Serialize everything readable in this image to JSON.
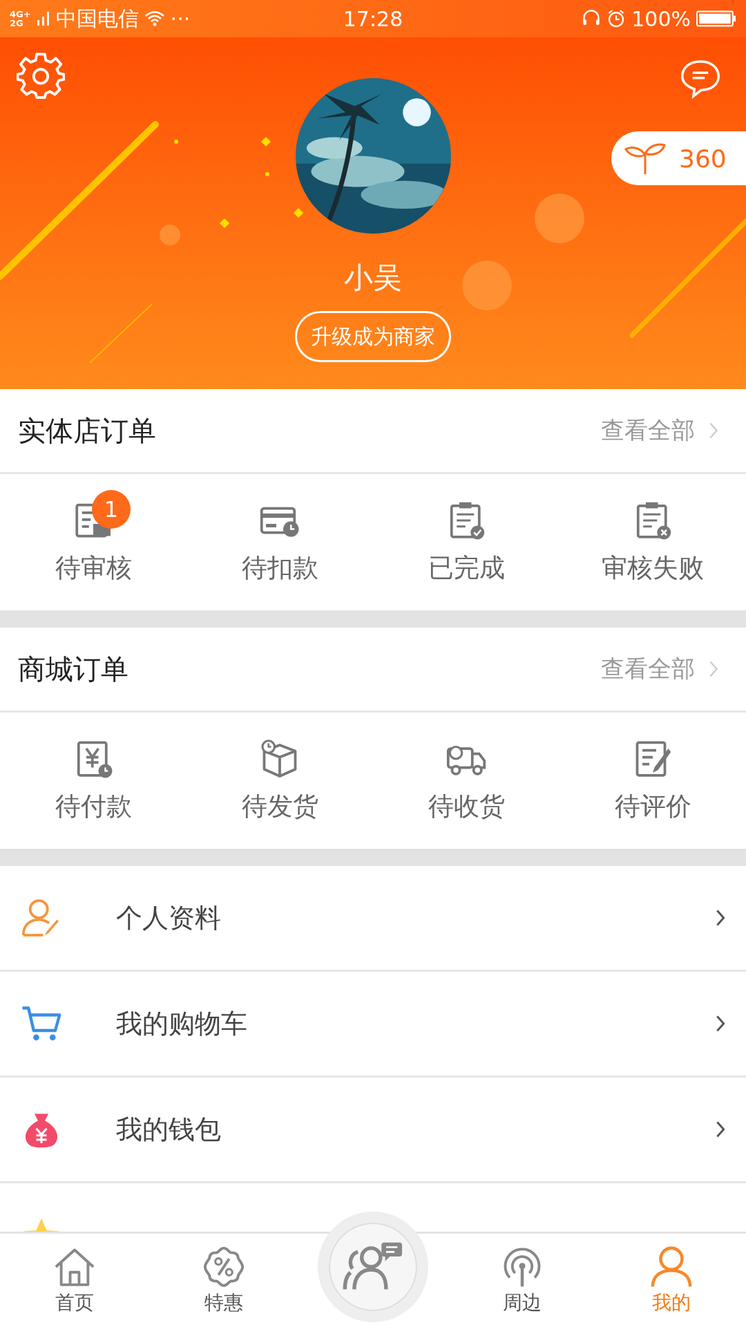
{
  "status_bar": {
    "network": [
      "4G+",
      "2G"
    ],
    "carrier": "中国电信",
    "more": "···",
    "time": "17:28",
    "battery": "100%"
  },
  "profile": {
    "name": "小吴",
    "upgrade_button": "升级成为商家",
    "points": "360"
  },
  "sections": [
    {
      "title": "实体店订单",
      "view_all": "查看全部",
      "items": [
        {
          "label": "待审核",
          "badge": "1"
        },
        {
          "label": "待扣款"
        },
        {
          "label": "已完成"
        },
        {
          "label": "审核失败"
        }
      ]
    },
    {
      "title": "商城订单",
      "view_all": "查看全部",
      "items": [
        {
          "label": "待付款"
        },
        {
          "label": "待发货"
        },
        {
          "label": "待收货"
        },
        {
          "label": "待评价"
        }
      ]
    }
  ],
  "menu": [
    {
      "label": "个人资料"
    },
    {
      "label": "我的购物车"
    },
    {
      "label": "我的钱包"
    },
    {
      "kind": "partial"
    }
  ],
  "tab_bar": [
    {
      "kind": "tab",
      "label": "首页",
      "selected": false
    },
    {
      "kind": "tab",
      "label": "特惠",
      "selected": false
    },
    {
      "kind": "center",
      "selected": false
    },
    {
      "kind": "tab",
      "label": "周边",
      "selected": false
    },
    {
      "kind": "tab",
      "label": "我的",
      "selected": true
    }
  ]
}
